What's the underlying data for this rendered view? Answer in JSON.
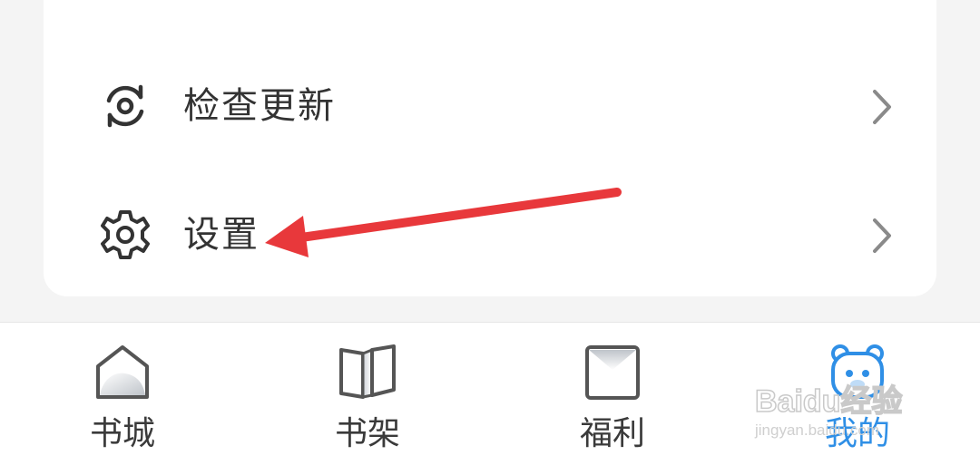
{
  "menu": {
    "items": [
      {
        "label": "检查更新",
        "icon": "refresh-sync-icon"
      },
      {
        "label": "设置",
        "icon": "gear-icon"
      }
    ]
  },
  "annotation": {
    "arrow_color": "#e8383b"
  },
  "tabbar": {
    "active_color": "#2f8fe6",
    "tabs": [
      {
        "label": "书城",
        "icon": "house-icon"
      },
      {
        "label": "书架",
        "icon": "open-book-icon"
      },
      {
        "label": "福利",
        "icon": "envelope-icon"
      },
      {
        "label": "我的",
        "icon": "bear-face-icon",
        "active": true
      }
    ]
  },
  "watermark": {
    "brand": "Baidu经验",
    "url": "jingyan.baidu.com"
  }
}
